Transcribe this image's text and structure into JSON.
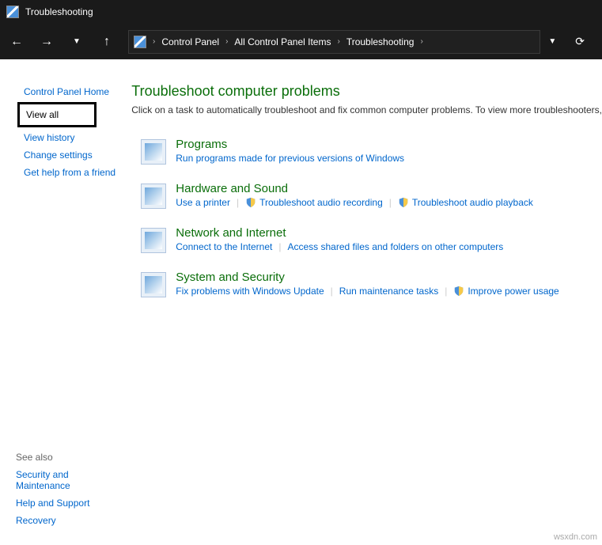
{
  "titlebar": {
    "title": "Troubleshooting"
  },
  "breadcrumb": {
    "items": [
      "Control Panel",
      "All Control Panel Items",
      "Troubleshooting"
    ]
  },
  "sidebar": {
    "top": {
      "home": "Control Panel Home",
      "view_all": "View all",
      "view_history": "View history",
      "change_settings": "Change settings",
      "get_help": "Get help from a friend"
    },
    "bottom": {
      "heading": "See also",
      "security": "Security and Maintenance",
      "help": "Help and Support",
      "recovery": "Recovery"
    }
  },
  "main": {
    "heading": "Troubleshoot computer problems",
    "description": "Click on a task to automatically troubleshoot and fix common computer problems. To view more troubleshooters,",
    "categories": {
      "programs": {
        "title": "Programs",
        "link1": "Run programs made for previous versions of Windows"
      },
      "hardware": {
        "title": "Hardware and Sound",
        "link1": "Use a printer",
        "link2": "Troubleshoot audio recording",
        "link3": "Troubleshoot audio playback"
      },
      "network": {
        "title": "Network and Internet",
        "link1": "Connect to the Internet",
        "link2": "Access shared files and folders on other computers"
      },
      "system": {
        "title": "System and Security",
        "link1": "Fix problems with Windows Update",
        "link2": "Run maintenance tasks",
        "link3": "Improve power usage"
      }
    }
  },
  "watermark": "wsxdn.com"
}
